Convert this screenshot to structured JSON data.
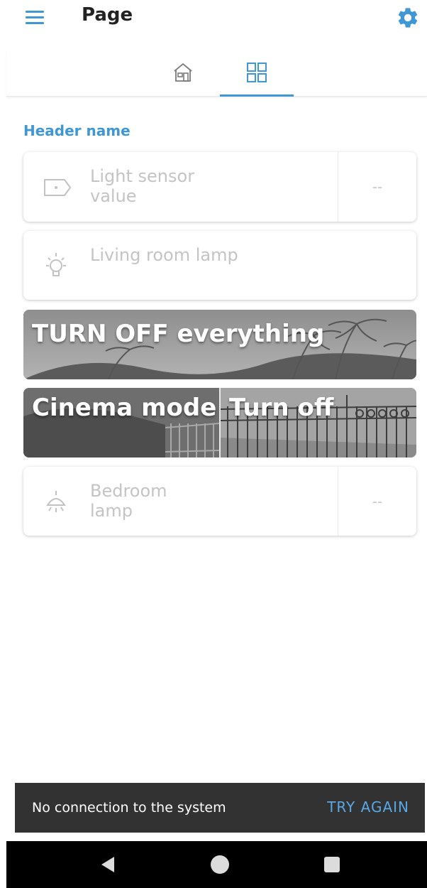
{
  "app_bar": {
    "title": "Page",
    "menu_icon": "hamburger-menu-icon",
    "settings_icon": "gear-icon",
    "accent_color": "#3f97d6"
  },
  "tabs": [
    {
      "icon": "house-icon",
      "selected": false
    },
    {
      "icon": "grid-icon",
      "selected": true
    }
  ],
  "section": {
    "header": "Header name"
  },
  "cards": {
    "light_sensor": {
      "label_line1": "Light sensor",
      "label_line2": "value",
      "value": "--",
      "icon": "tag-icon"
    },
    "living_room_lamp": {
      "label": "Living room lamp",
      "icon": "lightbulb-icon"
    },
    "bedroom_lamp": {
      "label_line1": "Bedroom",
      "label_line2": "lamp",
      "value": "--",
      "icon": "ceiling-lamp-icon"
    }
  },
  "scene_buttons": {
    "turn_off_everything": "TURN OFF everything",
    "cinema_mode": "Cinema mode",
    "turn_off": "Turn off"
  },
  "snackbar": {
    "message": "No connection to the system",
    "action": "TRY AGAIN"
  },
  "system_nav": {
    "back_icon": "back-triangle-icon",
    "home_icon": "home-circle-icon",
    "recents_icon": "recents-square-icon"
  }
}
